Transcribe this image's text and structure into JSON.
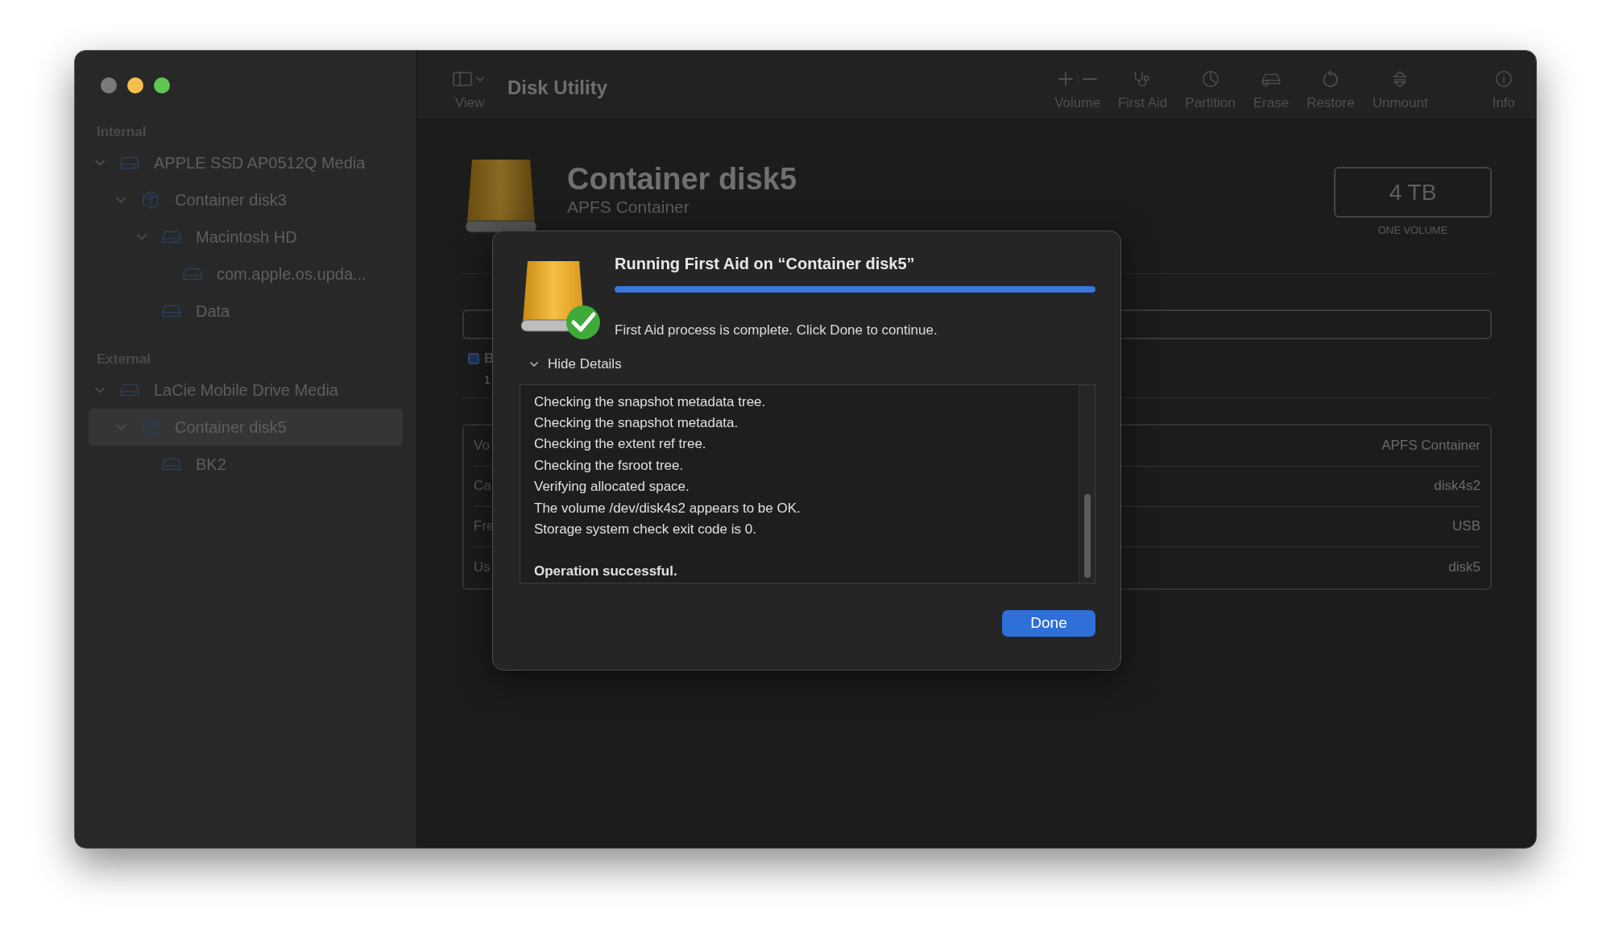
{
  "window": {
    "traffic_lights": [
      {
        "color": "#7a7a7a"
      },
      {
        "color": "#f5bf4f"
      },
      {
        "color": "#61c554"
      }
    ]
  },
  "sidebar": {
    "sections": [
      {
        "title": "Internal",
        "items": [
          {
            "label": "APPLE SSD AP0512Q Media",
            "kind": "drive",
            "expanded": true,
            "selected": false,
            "children": [
              {
                "label": "Container disk3",
                "kind": "container",
                "expanded": true,
                "selected": false,
                "children": [
                  {
                    "label": "Macintosh HD",
                    "kind": "drive",
                    "expanded": true,
                    "selected": false,
                    "children": [
                      {
                        "label": "com.apple.os.upda...",
                        "kind": "drive",
                        "selected": false
                      }
                    ]
                  },
                  {
                    "label": "Data",
                    "kind": "drive",
                    "selected": false
                  }
                ]
              }
            ]
          }
        ]
      },
      {
        "title": "External",
        "items": [
          {
            "label": "LaCie Mobile Drive Media",
            "kind": "drive",
            "expanded": true,
            "selected": false,
            "children": [
              {
                "label": "Container disk5",
                "kind": "container",
                "expanded": true,
                "selected": true,
                "children": [
                  {
                    "label": "BK2",
                    "kind": "drive",
                    "selected": false
                  }
                ]
              }
            ]
          }
        ]
      }
    ]
  },
  "toolbar": {
    "view_label": "View",
    "title": "Disk Utility",
    "buttons": [
      {
        "label": "Volume",
        "kind": "volume"
      },
      {
        "label": "First Aid",
        "kind": "first_aid"
      },
      {
        "label": "Partition",
        "kind": "partition"
      },
      {
        "label": "Erase",
        "kind": "erase"
      },
      {
        "label": "Restore",
        "kind": "restore"
      },
      {
        "label": "Unmount",
        "kind": "unmount"
      },
      {
        "label": "Info",
        "kind": "info"
      }
    ]
  },
  "header": {
    "title": "Container disk5",
    "subtitle": "APFS Container",
    "capacity": "4 TB",
    "capacity_caption": "ONE VOLUME"
  },
  "legend": {
    "label": "B",
    "value": "1"
  },
  "info_table": {
    "rows": [
      {
        "label": "Vo",
        "value": "APFS Container"
      },
      {
        "label": "Ca",
        "value": "disk4s2"
      },
      {
        "label": "Fre",
        "value": "USB"
      },
      {
        "label": "Us",
        "value": "disk5"
      }
    ]
  },
  "dialog": {
    "title": "Running First Aid on “Container disk5”",
    "progress": {
      "level": 1
    },
    "message": "First Aid process is complete. Click Done to continue.",
    "details_toggle": {
      "label": "Hide Details",
      "expanded": true
    },
    "log": {
      "lines": [
        "Checking the snapshot metadata tree.",
        "Checking the snapshot metadata.",
        "Checking the extent ref tree.",
        "Checking the fsroot tree.",
        "Verifying allocated space.",
        "The volume /dev/disk4s2 appears to be OK.",
        "Storage system check exit code is 0."
      ],
      "summary": "Operation successful."
    },
    "buttons": [
      {
        "label": "Done"
      }
    ]
  }
}
